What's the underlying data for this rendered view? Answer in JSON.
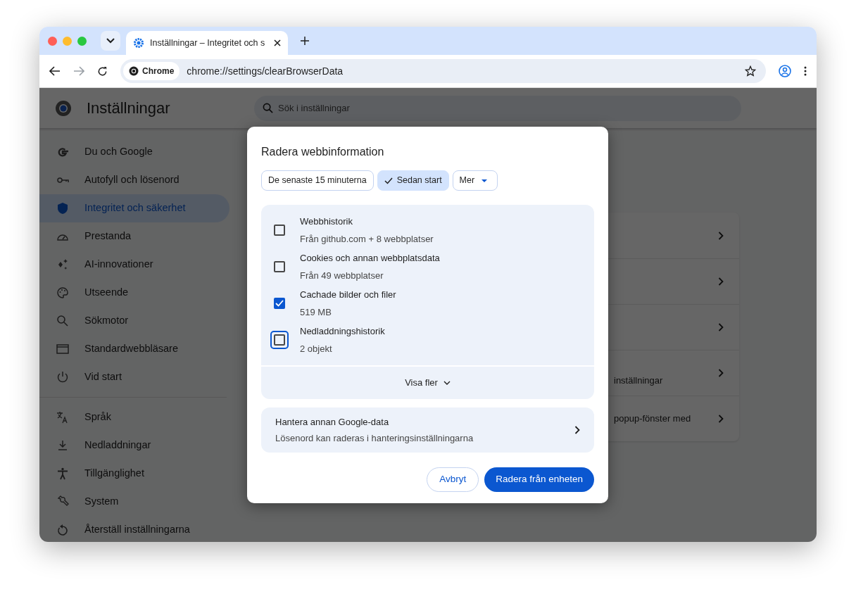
{
  "tab": {
    "title": "Inställningar – Integritet och s"
  },
  "address_bar": {
    "chip": "Chrome",
    "url": "chrome://settings/clearBrowserData"
  },
  "settings": {
    "title": "Inställningar",
    "search_placeholder": "Sök i inställningar",
    "sidebar": [
      {
        "label": "Du och Google",
        "selected": false
      },
      {
        "label": "Autofyll och lösenord",
        "selected": false
      },
      {
        "label": "Integritet och säkerhet",
        "selected": true
      },
      {
        "label": "Prestanda",
        "selected": false
      },
      {
        "label": "AI-innovationer",
        "selected": false
      },
      {
        "label": "Utseende",
        "selected": false
      },
      {
        "label": "Sökmotor",
        "selected": false
      },
      {
        "label": "Standardwebbläsare",
        "selected": false
      },
      {
        "label": "Vid start",
        "selected": false
      }
    ],
    "sidebar_more": [
      {
        "label": "Språk",
        "selected": false
      },
      {
        "label": "Nedladdningar",
        "selected": false
      },
      {
        "label": "Tillgänglighet",
        "selected": false
      },
      {
        "label": "System",
        "selected": false
      },
      {
        "label": "Återställ inställningarna",
        "selected": false
      }
    ],
    "card_rows": [
      {
        "text_fragment": ""
      },
      {
        "text_fragment": ""
      },
      {
        "text_fragment": ""
      },
      {
        "text_fragment": "inställningar"
      },
      {
        "text_fragment": "popup-fönster med"
      }
    ]
  },
  "dialog": {
    "title": "Radera webbinformation",
    "time_ranges": [
      {
        "label": "De senaste 15 minuterna",
        "selected": false,
        "kind": "chip"
      },
      {
        "label": "Sedan start",
        "selected": true,
        "kind": "chip"
      },
      {
        "label": "Mer",
        "selected": false,
        "kind": "dropdown"
      }
    ],
    "items": [
      {
        "title": "Webbhistorik",
        "detail": "Från github.com + 8 webbplatser",
        "checked": false,
        "focused": false
      },
      {
        "title": "Cookies och annan webbplatsdata",
        "detail": "Från 49 webbplatser",
        "checked": false,
        "focused": false
      },
      {
        "title": "Cachade bilder och filer",
        "detail": "519 MB",
        "checked": true,
        "focused": false
      },
      {
        "title": "Nedladdningshistorik",
        "detail": "2 objekt",
        "checked": false,
        "focused": true
      }
    ],
    "show_more": "Visa fler",
    "manage": {
      "title": "Hantera annan Google-data",
      "detail": "Lösenord kan raderas i hanteringsinställningarna"
    },
    "buttons": [
      {
        "label": "Avbryt",
        "kind": "secondary"
      },
      {
        "label": "Radera från enheten",
        "kind": "primary"
      }
    ]
  }
}
